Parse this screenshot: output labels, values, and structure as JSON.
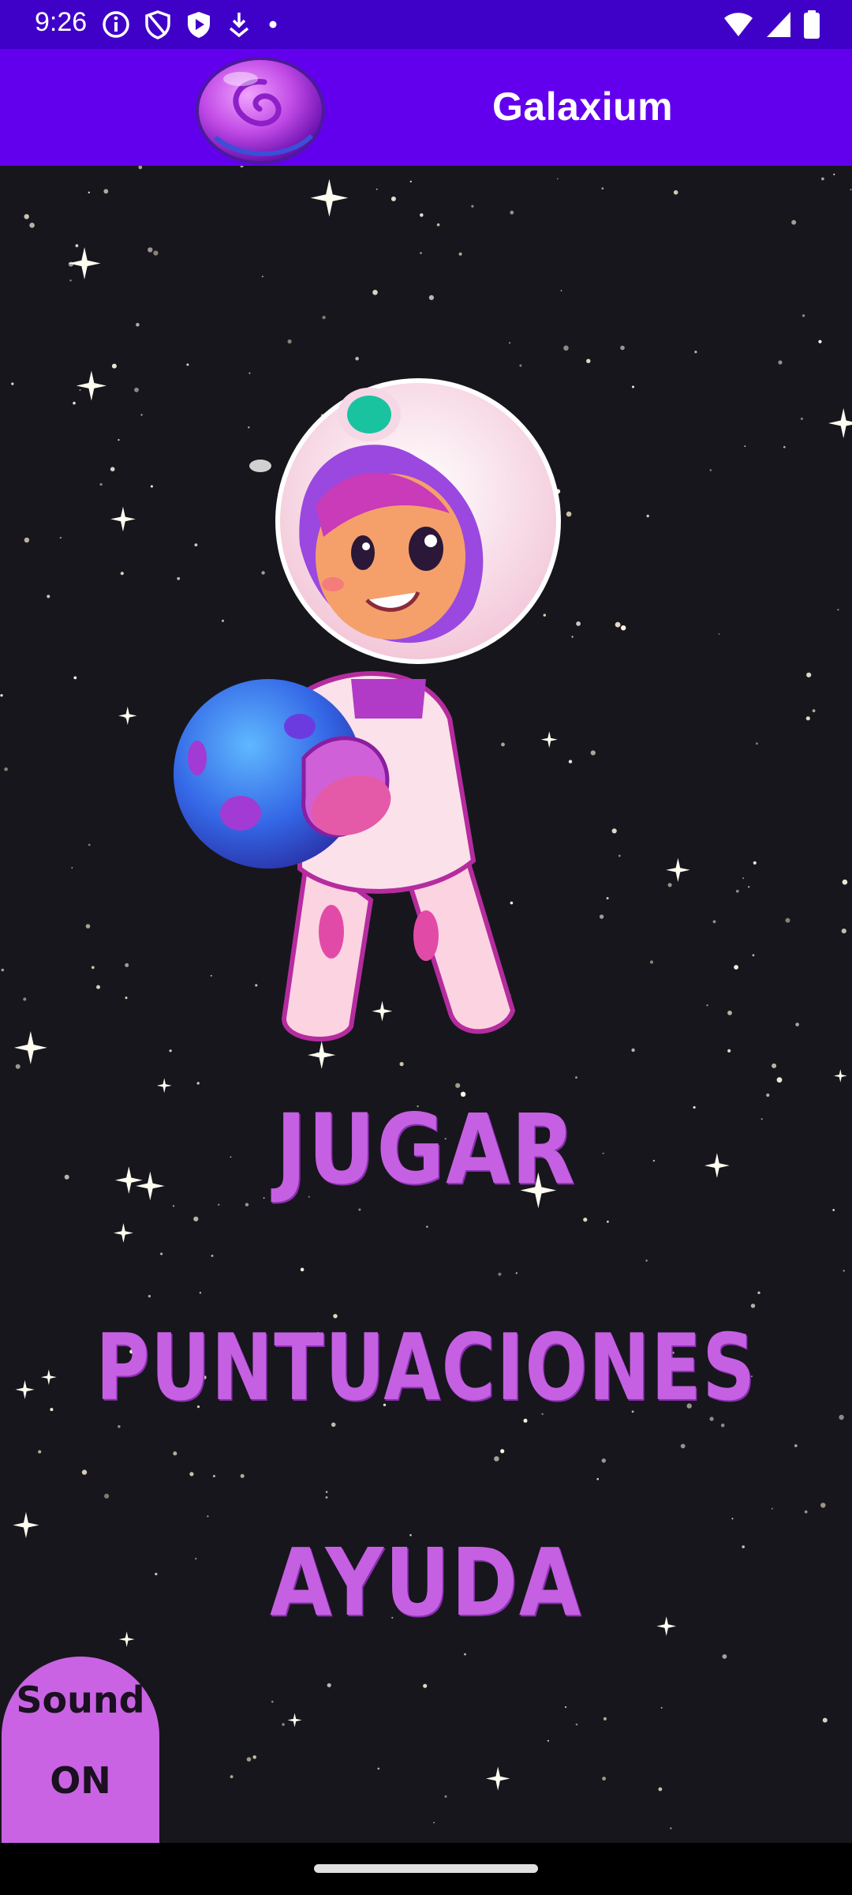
{
  "status_bar": {
    "time": "9:26",
    "left_icons": [
      "info-icon",
      "shield-icon",
      "play-shield-icon",
      "download-icon",
      "dot-icon"
    ],
    "right_icons": [
      "wifi-icon",
      "signal-icon",
      "battery-icon"
    ]
  },
  "app_bar": {
    "title": "Galaxium",
    "logo": "galaxy-planet-logo",
    "background": "#6200ee"
  },
  "menu": {
    "play": "JUGAR",
    "scores": "PUNTUACIONES",
    "help": "AYUDA",
    "color": "#c660e3"
  },
  "sound_button": {
    "line1": "Sound",
    "line2": "ON",
    "color": "#c963e3"
  },
  "colors": {
    "status_bar": "#3f00c8",
    "space_background": "#17161c"
  }
}
